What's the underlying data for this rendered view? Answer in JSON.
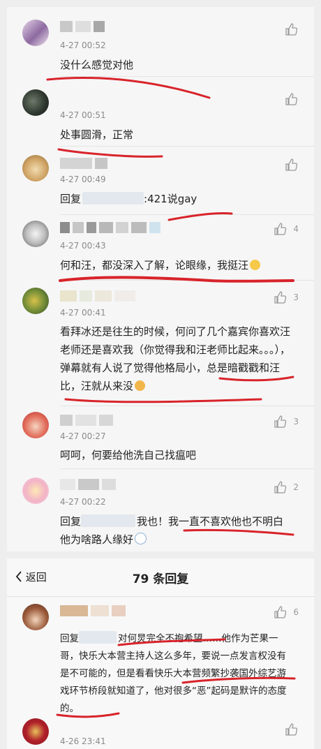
{
  "comments": [
    {
      "time": "4-27 00:52",
      "text": "没什么感觉对他",
      "likes": ""
    },
    {
      "time": "4-27 00:51",
      "text": "处事圆滑，正常",
      "likes": ""
    },
    {
      "time": "4-27 00:49",
      "reply_prefix": "回复",
      "reply_suffix": ":421说gay",
      "likes": ""
    },
    {
      "time": "4-27 00:43",
      "text": "何和汪，都没深入了解，论眼缘，我挺汪",
      "likes": "4"
    },
    {
      "time": "4-27 00:41",
      "text": "看拜冰还是往生的时候，何问了几个嘉宾你喜欢汪老师还是喜欢我（你觉得我和汪老师比起来。。。），弹幕就有人说了觉得他格局小，总是暗戳戳和汪比，汪就从来没",
      "likes": "3"
    },
    {
      "time": "4-27 00:27",
      "text": "呵呵，何要给他洗自己找瘟吧",
      "likes": "3"
    },
    {
      "time": "4-27 00:22",
      "reply_prefix": "回复",
      "reply_suffix": "我也！我一直不喜欢他也不明白他为啥路人缘好",
      "likes": "2"
    }
  ],
  "header": {
    "back_label": "返回",
    "title": "79 条回复"
  },
  "thread": [
    {
      "likes": "6",
      "reply_prefix": "回复",
      "text": "对何炅完全不抱希望……他作为芒果一哥，快乐大本营主持人这么多年，要说一点发言权没有是不可能的，但是看看快乐大本营频繁抄袭国外综艺游戏环节桥段就知道了，他对很多“恶”起码是默许的态度的。"
    },
    {
      "time": "4-26 23:41",
      "likes": ""
    }
  ],
  "colors": {
    "underline": "#d8232a",
    "text": "#222222",
    "meta": "#8a8a8a"
  }
}
